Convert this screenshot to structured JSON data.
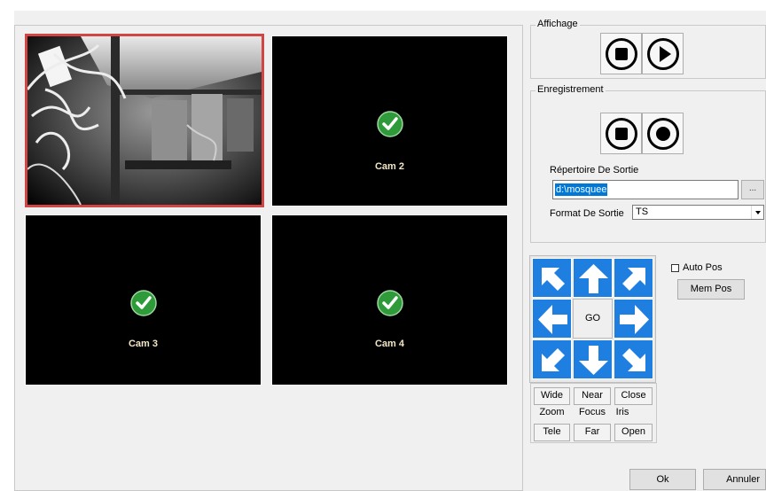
{
  "cameras": [
    {
      "label": "",
      "status": "live-feed",
      "selected": true
    },
    {
      "label": "Cam 2",
      "status": "ok",
      "selected": false
    },
    {
      "label": "Cam 3",
      "status": "ok",
      "selected": false
    },
    {
      "label": "Cam 4",
      "status": "ok",
      "selected": false
    }
  ],
  "display_group": {
    "title": "Affichage",
    "buttons": [
      {
        "icon": "stop-icon"
      },
      {
        "icon": "play-icon"
      }
    ]
  },
  "recording_group": {
    "title": "Enregistrement",
    "buttons": [
      {
        "icon": "stop-icon"
      },
      {
        "icon": "record-icon"
      }
    ],
    "output_dir_label": "Répertoire De Sortie",
    "output_dir_value": "d:\\mosquee",
    "browse_label": "...",
    "output_format_label": "Format De Sortie",
    "output_format_value": "TS"
  },
  "ptz": {
    "go_label": "GO",
    "directions": [
      "up-left",
      "up",
      "up-right",
      "left",
      "right",
      "down-left",
      "down",
      "down-right"
    ],
    "auto_pos_label": "Auto Pos",
    "auto_pos_checked": false,
    "mem_pos_label": "Mem Pos",
    "zoom": {
      "plus": "Wide",
      "label": "Zoom",
      "minus": "Tele"
    },
    "focus": {
      "plus": "Near",
      "label": "Focus",
      "minus": "Far"
    },
    "iris": {
      "plus": "Close",
      "label": "Iris",
      "minus": "Open"
    }
  },
  "dialog": {
    "ok_label": "Ok",
    "cancel_label": "Annuler"
  },
  "colors": {
    "selected_border": "#d24545",
    "ptz_blue": "#1e7fe0",
    "cam_label": "#f2e7c4",
    "check_green": "#2e9a3a",
    "selection": "#0078d7"
  }
}
